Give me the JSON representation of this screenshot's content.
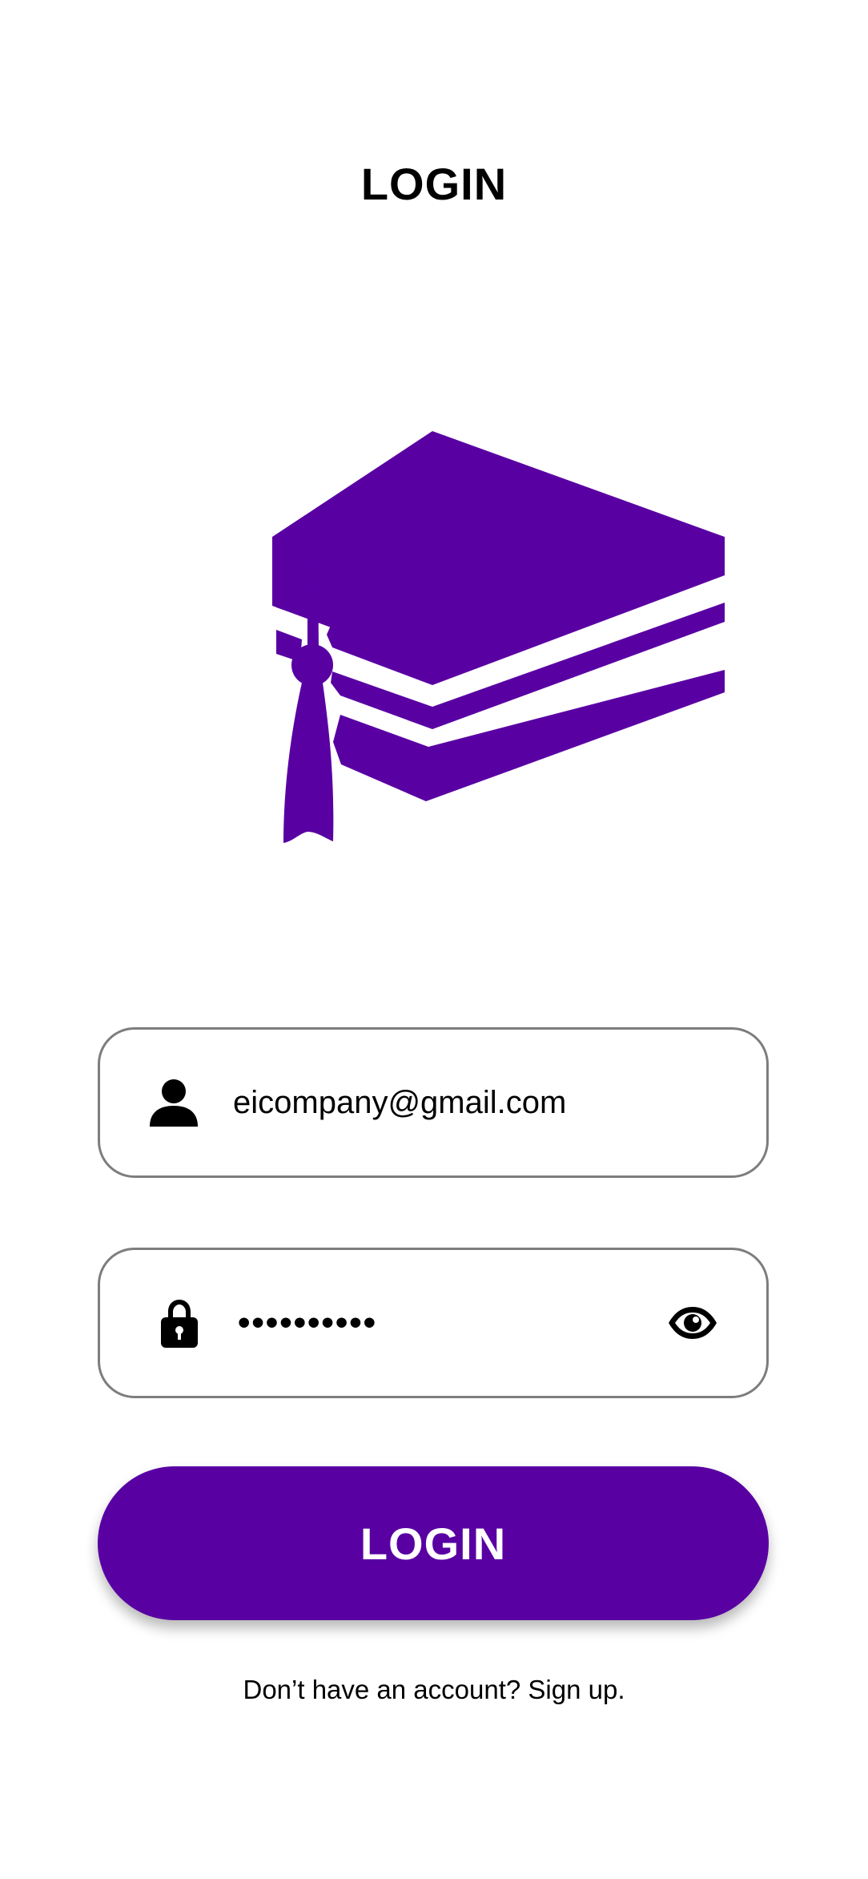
{
  "header": {
    "title": "LOGIN"
  },
  "logo": {
    "icon": "graduation-cap-icon",
    "color": "#5900a3"
  },
  "email_field": {
    "icon": "user-icon",
    "value": "eicompany@gmail.com"
  },
  "password_field": {
    "icon": "lock-icon",
    "value": "••••••••••",
    "toggle_icon": "eye-icon"
  },
  "login_button": {
    "label": "LOGIN",
    "color": "#5900a3"
  },
  "signup": {
    "prompt": "Don’t have an account?",
    "link": "Sign up."
  }
}
